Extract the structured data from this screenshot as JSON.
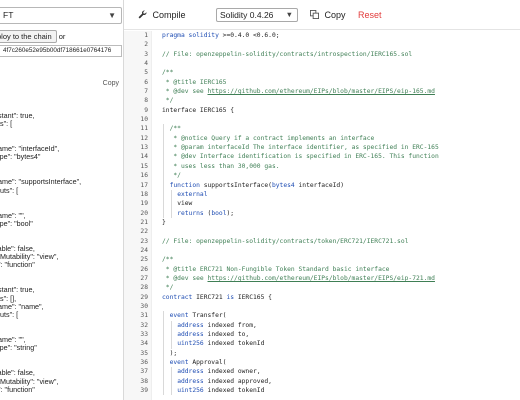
{
  "left_panel": {
    "contract_select": "FT",
    "deploy_button": "ploy to the chain",
    "deploy_suffix": " or",
    "address": "4f7c260e52e95b00df718661e0764176",
    "copy_label": "Copy",
    "abi_lines": [
      "nstant\": true,",
      "uts\": [",
      "",
      "",
      "name\": \"interfaceId\",",
      "type\": \"bytes4\"",
      "",
      "",
      "name\": \"supportsInterface\",",
      "tputs\": [",
      "",
      "",
      "name\": \"\",",
      "type\": \"bool\"",
      "",
      "",
      "yable\": false,",
      "teMutability\": \"view\",",
      "e\": \"function\"",
      "",
      "",
      "nstant\": true,",
      "uts\": [],",
      "name\": \"name\",",
      "tputs\": [",
      "",
      "",
      "name\": \"\",",
      "type\": \"string\"",
      "",
      "",
      "yable\": false,",
      "teMutability\": \"view\",",
      "e\": \"function\"",
      "",
      "",
      "nstant\": true,"
    ]
  },
  "toolbar": {
    "compile_label": "Compile",
    "compile_icon": "wrench-icon",
    "version": "Solidity 0.4.26",
    "copy_label": "Copy",
    "copy_icon": "copy-icon",
    "reset_label": "Reset",
    "reset_color": "#e23b3b"
  },
  "editor": {
    "lines": [
      {
        "n": "1",
        "indent": 0,
        "parts": [
          [
            "kw",
            "pragma solidity "
          ],
          [
            "plain",
            ">=0.4.0 <0.6.0;"
          ]
        ]
      },
      {
        "n": "2",
        "indent": 0,
        "parts": []
      },
      {
        "n": "3",
        "indent": 0,
        "parts": [
          [
            "comment",
            "// File: openzeppelin-solidity/contracts/introspection/IERC165.sol"
          ]
        ]
      },
      {
        "n": "4",
        "indent": 0,
        "parts": []
      },
      {
        "n": "5",
        "indent": 0,
        "parts": [
          [
            "comment",
            "/**"
          ]
        ]
      },
      {
        "n": "6",
        "indent": 0,
        "parts": [
          [
            "comment",
            " * @title IERC165"
          ]
        ]
      },
      {
        "n": "7",
        "indent": 0,
        "parts": [
          [
            "comment",
            " * @dev see "
          ],
          [
            "link",
            "https://github.com/ethereum/EIPs/blob/master/EIPS/eip-165.md"
          ]
        ]
      },
      {
        "n": "8",
        "indent": 0,
        "parts": [
          [
            "comment",
            " */"
          ]
        ]
      },
      {
        "n": "9",
        "indent": 0,
        "parts": [
          [
            "plain",
            "interface IERC165 {"
          ]
        ]
      },
      {
        "n": "10",
        "indent": 0,
        "parts": []
      },
      {
        "n": "11",
        "indent": 1,
        "parts": [
          [
            "comment",
            "/**"
          ]
        ]
      },
      {
        "n": "12",
        "indent": 1,
        "parts": [
          [
            "comment",
            " * @notice Query if a contract implements an interface"
          ]
        ]
      },
      {
        "n": "13",
        "indent": 1,
        "parts": [
          [
            "comment",
            " * @param interfaceId The interface identifier, as specified in ERC-165"
          ]
        ]
      },
      {
        "n": "14",
        "indent": 1,
        "parts": [
          [
            "comment",
            " * @dev Interface identification is specified in ERC-165. This function"
          ]
        ]
      },
      {
        "n": "15",
        "indent": 1,
        "parts": [
          [
            "comment",
            " * uses less than 30,000 gas."
          ]
        ]
      },
      {
        "n": "16",
        "indent": 1,
        "parts": [
          [
            "comment",
            " */"
          ]
        ]
      },
      {
        "n": "17",
        "indent": 1,
        "parts": [
          [
            "kw",
            "function "
          ],
          [
            "plain",
            "supportsInterface("
          ],
          [
            "kw",
            "bytes4"
          ],
          [
            "plain",
            " interfaceId)"
          ]
        ]
      },
      {
        "n": "18",
        "indent": 2,
        "parts": [
          [
            "kw",
            "external"
          ]
        ]
      },
      {
        "n": "19",
        "indent": 2,
        "parts": [
          [
            "plain",
            "view"
          ]
        ]
      },
      {
        "n": "20",
        "indent": 2,
        "parts": [
          [
            "kw",
            "returns"
          ],
          [
            "plain",
            " ("
          ],
          [
            "kw",
            "bool"
          ],
          [
            "plain",
            ");"
          ]
        ]
      },
      {
        "n": "21",
        "indent": 0,
        "parts": [
          [
            "plain",
            "}"
          ]
        ]
      },
      {
        "n": "22",
        "indent": 0,
        "parts": []
      },
      {
        "n": "23",
        "indent": 0,
        "parts": [
          [
            "comment",
            "// File: openzeppelin-solidity/contracts/token/ERC721/IERC721.sol"
          ]
        ]
      },
      {
        "n": "24",
        "indent": 0,
        "parts": []
      },
      {
        "n": "25",
        "indent": 0,
        "parts": [
          [
            "comment",
            "/**"
          ]
        ]
      },
      {
        "n": "26",
        "indent": 0,
        "parts": [
          [
            "comment",
            " * @title ERC721 Non-Fungible Token Standard basic interface"
          ]
        ]
      },
      {
        "n": "27",
        "indent": 0,
        "parts": [
          [
            "comment",
            " * @dev see "
          ],
          [
            "link",
            "https://github.com/ethereum/EIPs/blob/master/EIPS/eip-721.md"
          ]
        ]
      },
      {
        "n": "28",
        "indent": 0,
        "parts": [
          [
            "comment",
            " */"
          ]
        ]
      },
      {
        "n": "29",
        "indent": 0,
        "parts": [
          [
            "kw",
            "contract "
          ],
          [
            "plain",
            "IERC721 "
          ],
          [
            "kw",
            "is "
          ],
          [
            "plain",
            "IERC165 {"
          ]
        ]
      },
      {
        "n": "30",
        "indent": 0,
        "parts": []
      },
      {
        "n": "31",
        "indent": 1,
        "parts": [
          [
            "kw",
            "event "
          ],
          [
            "plain",
            "Transfer("
          ]
        ]
      },
      {
        "n": "32",
        "indent": 2,
        "parts": [
          [
            "kw",
            "address"
          ],
          [
            "plain",
            " indexed from,"
          ]
        ]
      },
      {
        "n": "33",
        "indent": 2,
        "parts": [
          [
            "kw",
            "address"
          ],
          [
            "plain",
            " indexed to,"
          ]
        ]
      },
      {
        "n": "34",
        "indent": 2,
        "parts": [
          [
            "kw",
            "uint256"
          ],
          [
            "plain",
            " indexed tokenId"
          ]
        ]
      },
      {
        "n": "35",
        "indent": 1,
        "parts": [
          [
            "plain",
            ");"
          ]
        ]
      },
      {
        "n": "36",
        "indent": 1,
        "parts": [
          [
            "kw",
            "event "
          ],
          [
            "plain",
            "Approval("
          ]
        ]
      },
      {
        "n": "37",
        "indent": 2,
        "parts": [
          [
            "kw",
            "address"
          ],
          [
            "plain",
            " indexed owner,"
          ]
        ]
      },
      {
        "n": "38",
        "indent": 2,
        "parts": [
          [
            "kw",
            "address"
          ],
          [
            "plain",
            " indexed approved,"
          ]
        ]
      },
      {
        "n": "39",
        "indent": 2,
        "parts": [
          [
            "kw",
            "uint256"
          ],
          [
            "plain",
            " indexed tokenId"
          ]
        ]
      }
    ]
  }
}
